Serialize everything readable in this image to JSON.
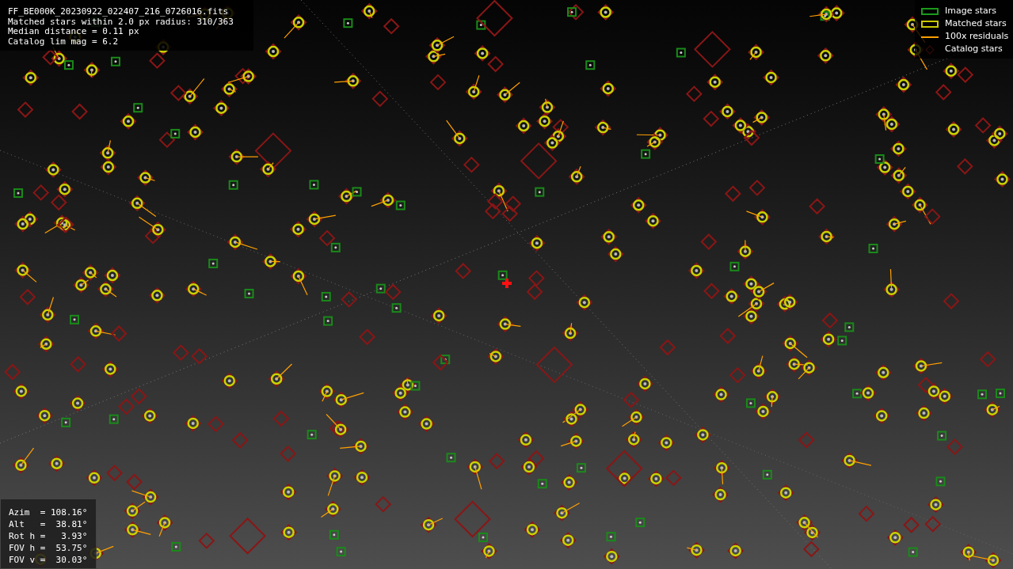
{
  "info": {
    "lines": [
      "FF_BE000K_20230922_022407_216_0726016.fits",
      "Matched stars within 2.0 px radius: 310/363",
      "Median distance = 0.11 px",
      "Catalog lim mag = 6.2"
    ]
  },
  "legend": [
    {
      "label": "Image stars",
      "kind": "image"
    },
    {
      "label": "Matched stars",
      "kind": "matched"
    },
    {
      "label": "100x residuals",
      "kind": "residuals"
    },
    {
      "label": "Catalog stars",
      "kind": "catalog"
    }
  ],
  "pointing": {
    "lines": [
      "Azim  = 108.16°",
      "Alt   =  38.81°",
      "Rot h =   3.93°",
      "FOV h =  53.75°",
      "FOV v =  30.03°"
    ]
  }
}
